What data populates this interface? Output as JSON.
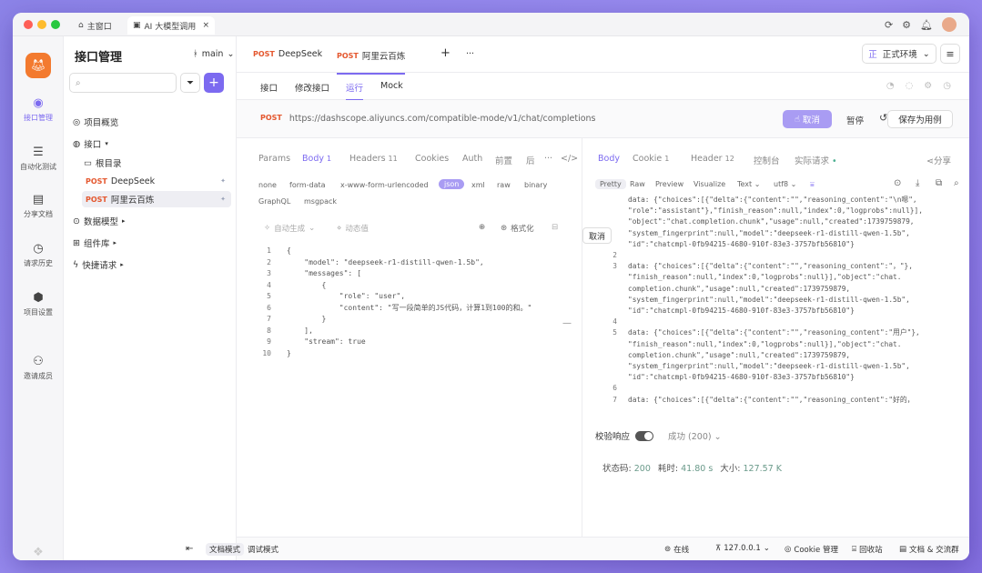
{
  "titlebar": {
    "tabs": [
      {
        "label": "主窗口"
      },
      {
        "label": "AI 大模型调用"
      }
    ]
  },
  "rail": {
    "items": [
      {
        "label": "接口管理",
        "icon": "api-icon"
      },
      {
        "label": "自动化测试",
        "icon": "automation-icon"
      },
      {
        "label": "分享文档",
        "icon": "book-icon"
      },
      {
        "label": "请求历史",
        "icon": "clock-icon"
      },
      {
        "label": "项目设置",
        "icon": "settings-icon"
      },
      {
        "label": "邀请成员",
        "icon": "invite-icon"
      }
    ]
  },
  "tree": {
    "title": "接口管理",
    "search_placeholder": "",
    "overview": "项目概览",
    "interfaces": "接口",
    "root": "根目录",
    "items": [
      {
        "method": "POST",
        "name": "DeepSeek"
      },
      {
        "method": "POST",
        "name": "阿里云百炼"
      }
    ],
    "data_models": "数据模型",
    "components": "组件库",
    "quick_requests": "快捷请求"
  },
  "main": {
    "branch": "main",
    "tabs": [
      {
        "method": "POST",
        "name": "DeepSeek"
      },
      {
        "method": "POST",
        "name": "阿里云百炼"
      }
    ],
    "env": "正式环境",
    "subtabs": [
      "接口",
      "修改接口",
      "运行",
      "Mock"
    ],
    "url_method": "POST",
    "url": "https://dashscope.aliyuncs.com/compatible-mode/v1/chat/completions",
    "cancel": "取消",
    "pause": "暂停",
    "save": "保存为用例"
  },
  "request": {
    "tabs": [
      {
        "label": "Params",
        "count": ""
      },
      {
        "label": "Body",
        "count": "1"
      },
      {
        "label": "Headers",
        "count": "11"
      },
      {
        "label": "Cookies",
        "count": ""
      },
      {
        "label": "Auth",
        "count": ""
      },
      {
        "label": "前置",
        "count": ""
      },
      {
        "label": "后",
        "count": ""
      }
    ],
    "body_types": [
      "none",
      "form-data",
      "x-www-form-urlencoded",
      "json",
      "xml",
      "raw",
      "binary",
      "GraphQL",
      "msgpack"
    ],
    "auto_generate": "自动生成",
    "dynamic_value": "动态值",
    "format": "格式化",
    "code": [
      "{",
      "    \"model\": \"deepseek-r1-distill-qwen-1.5b\",",
      "    \"messages\": [",
      "        {",
      "            \"role\": \"user\",",
      "            \"content\": \"写一段简单的JS代码，计算1到100的和。\"",
      "        }",
      "    ],",
      "    \"stream\": true",
      "}"
    ]
  },
  "response": {
    "tabs": [
      {
        "label": "Body",
        "count": ""
      },
      {
        "label": "Cookie",
        "count": "1"
      },
      {
        "label": "Header",
        "count": "12"
      },
      {
        "label": "控制台",
        "count": ""
      },
      {
        "label": "实际请求",
        "count": ""
      }
    ],
    "share": "分享",
    "view_tabs": [
      "Pretty",
      "Raw",
      "Preview",
      "Visualize",
      "Text",
      "utf8"
    ],
    "cancel": "取消",
    "lines": [
      {
        "n": "",
        "t": "data: {\"choices\":[{\"delta\":{\"content\":\"\",\"reasoning_content\":\"\\n嗯\","
      },
      {
        "n": "",
        "t": "\"role\":\"assistant\"},\"finish_reason\":null,\"index\":0,\"logprobs\":null}],"
      },
      {
        "n": "",
        "t": "\"object\":\"chat.completion.chunk\",\"usage\":null,\"created\":1739759879,"
      },
      {
        "n": "",
        "t": "\"system_fingerprint\":null,\"model\":\"deepseek-r1-distill-qwen-1.5b\","
      },
      {
        "n": "",
        "t": "\"id\":\"chatcmpl-0fb94215-4680-910f-83e3-3757bfb56810\"}"
      },
      {
        "n": "2",
        "t": ""
      },
      {
        "n": "3",
        "t": "data: {\"choices\":[{\"delta\":{\"content\":\"\",\"reasoning_content\":\"，\"},"
      },
      {
        "n": "",
        "t": "\"finish_reason\":null,\"index\":0,\"logprobs\":null}],\"object\":\"chat."
      },
      {
        "n": "",
        "t": "completion.chunk\",\"usage\":null,\"created\":1739759879,"
      },
      {
        "n": "",
        "t": "\"system_fingerprint\":null,\"model\":\"deepseek-r1-distill-qwen-1.5b\","
      },
      {
        "n": "",
        "t": "\"id\":\"chatcmpl-0fb94215-4680-910f-83e3-3757bfb56810\"}"
      },
      {
        "n": "4",
        "t": ""
      },
      {
        "n": "5",
        "t": "data: {\"choices\":[{\"delta\":{\"content\":\"\",\"reasoning_content\":\"用户\"},"
      },
      {
        "n": "",
        "t": "\"finish_reason\":null,\"index\":0,\"logprobs\":null}],\"object\":\"chat."
      },
      {
        "n": "",
        "t": "completion.chunk\",\"usage\":null,\"created\":1739759879,"
      },
      {
        "n": "",
        "t": "\"system_fingerprint\":null,\"model\":\"deepseek-r1-distill-qwen-1.5b\","
      },
      {
        "n": "",
        "t": "\"id\":\"chatcmpl-0fb94215-4680-910f-83e3-3757bfb56810\"}"
      },
      {
        "n": "6",
        "t": ""
      },
      {
        "n": "7",
        "t": "data: {\"choices\":[{\"delta\":{\"content\":\"\",\"reasoning_content\":\"好的，"
      }
    ],
    "validate": "校验响应",
    "success": "成功 (200)",
    "status_label": "状态码:",
    "status_code": "200",
    "time_label": "耗时:",
    "time": "41.80 s",
    "size_label": "大小:",
    "size": "127.57 K"
  },
  "bottom": {
    "doc_mode": "文档模式",
    "debug_mode": "调试模式",
    "online": "在线",
    "proxy": "127.0.0.1",
    "cookie": "Cookie 管理",
    "recycle": "回收站",
    "docs": "文档 & 交流群"
  }
}
